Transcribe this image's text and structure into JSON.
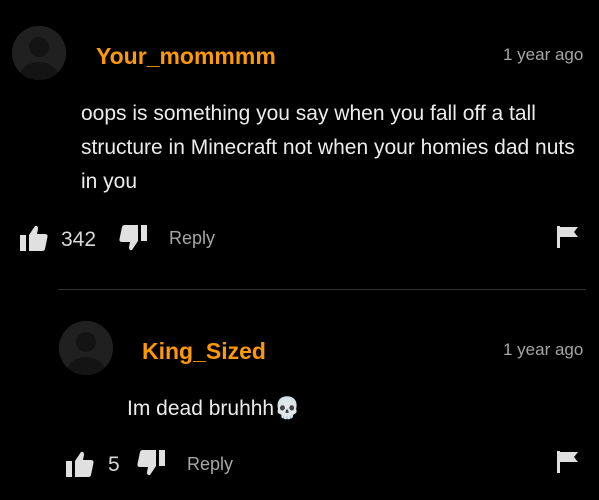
{
  "comments": [
    {
      "username": "Your_mommmm",
      "timestamp": "1 year ago",
      "text": "oops is something you say when you fall off a tall structure in Minecraft not when your homies dad nuts in you",
      "likes": "342",
      "reply_label": "Reply",
      "avatar_icon": "default-user-avatar-icon"
    }
  ],
  "replies": [
    {
      "username": "King_Sized",
      "timestamp": "1 year ago",
      "text": "Im dead bruhhh",
      "emoji": "💀",
      "likes": "5",
      "reply_label": "Reply",
      "avatar_icon": "default-user-avatar-icon"
    }
  ],
  "colors": {
    "background": "#000000",
    "username": "#ff9900",
    "body_text": "#ececec",
    "muted_text": "#a6a6a6",
    "divider": "#333333"
  },
  "icons": {
    "like": "thumbs-up-icon",
    "dislike": "thumbs-down-icon",
    "report": "flag-icon"
  }
}
